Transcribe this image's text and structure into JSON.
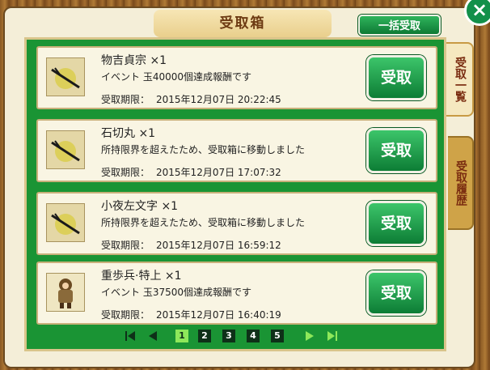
{
  "title": "受取箱",
  "collect_all_label": "一括受取",
  "close_symbol": "×",
  "tabs": [
    {
      "label": "受取一覧",
      "active": true
    },
    {
      "label": "受取履歴",
      "active": false
    }
  ],
  "deadline_label": "受取期限：",
  "receive_label": "受取",
  "items": [
    {
      "name": "物吉貞宗 ×1",
      "desc": "イベント 玉40000個達成報酬です",
      "deadline": "2015年12月07日 20:22:45",
      "icon": "sword-icon"
    },
    {
      "name": "石切丸 ×1",
      "desc": "所持限界を超えたため、受取箱に移動しました",
      "deadline": "2015年12月07日 17:07:32",
      "icon": "sword-icon"
    },
    {
      "name": "小夜左文字 ×1",
      "desc": "所持限界を超えたため、受取箱に移動しました",
      "deadline": "2015年12月07日 16:59:12",
      "icon": "sword-icon"
    },
    {
      "name": "重歩兵·特上 ×1",
      "desc": "イベント 玉37500個達成報酬です",
      "deadline": "2015年12月07日 16:40:19",
      "icon": "soldier-icon"
    }
  ],
  "pager": {
    "pages": [
      "1",
      "2",
      "3",
      "4",
      "5"
    ],
    "current": "1"
  },
  "colors": {
    "panel_green": "#1a9434",
    "button_green": "#0e7a34",
    "title_brown": "#6d3a12"
  }
}
